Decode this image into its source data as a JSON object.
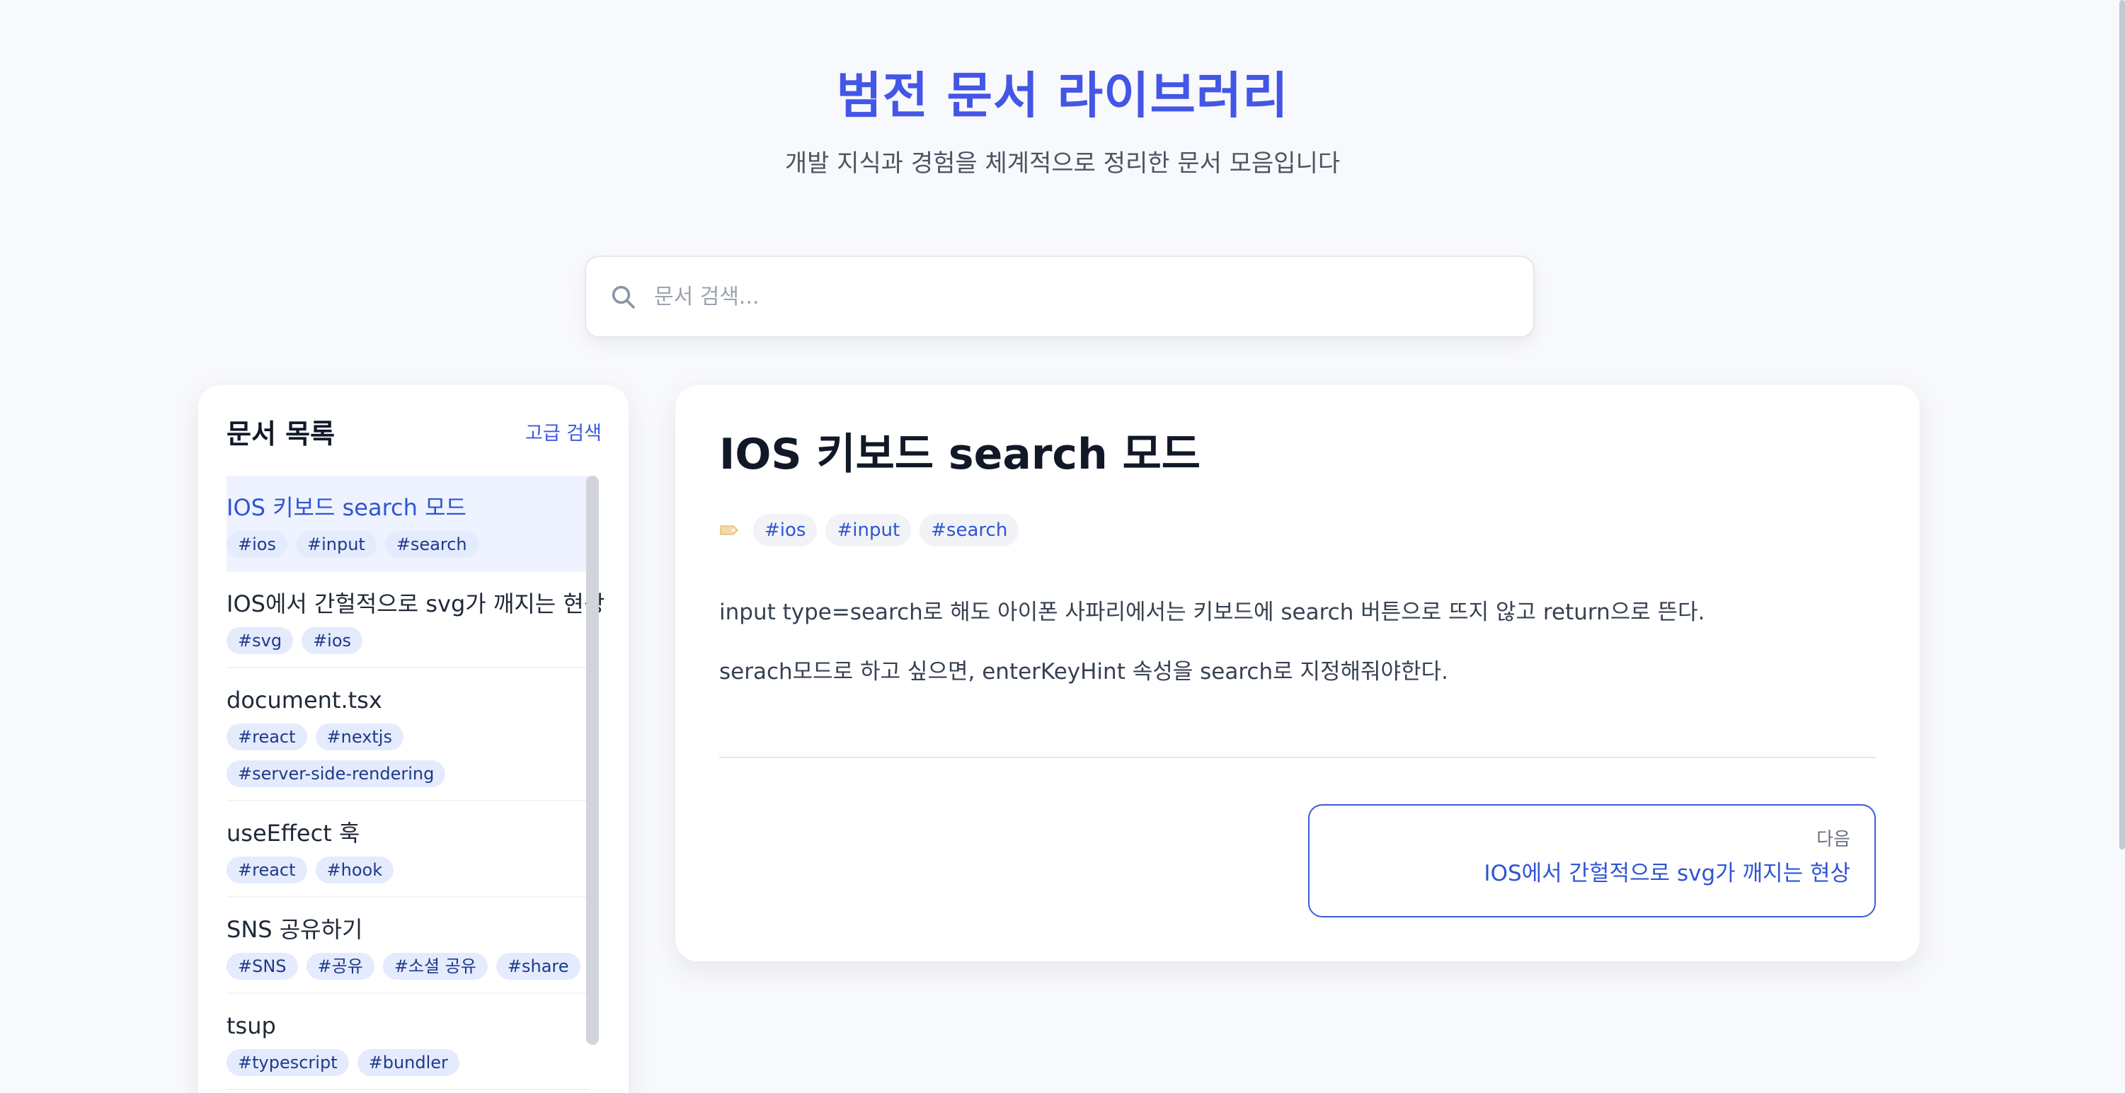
{
  "header": {
    "title": "범전 문서 라이브러리",
    "subtitle": "개발 지식과 경험을 체계적으로 정리한 문서 모음입니다"
  },
  "search": {
    "placeholder": "문서 검색...",
    "value": "",
    "icon": "search-icon"
  },
  "sidebar": {
    "title": "문서 목록",
    "advanced_search_label": "고급 검색",
    "items": [
      {
        "title": "IOS 키보드 search 모드",
        "tags": [
          "#ios",
          "#input",
          "#search"
        ],
        "active": true
      },
      {
        "title": "IOS에서 간헐적으로 svg가 깨지는 현상",
        "tags": [
          "#svg",
          "#ios"
        ]
      },
      {
        "title": "document.tsx",
        "tags": [
          "#react",
          "#nextjs",
          "#server-side-rendering"
        ]
      },
      {
        "title": "useEffect 훅",
        "tags": [
          "#react",
          "#hook"
        ]
      },
      {
        "title": "SNS 공유하기",
        "tags": [
          "#SNS",
          "#공유",
          "#소셜 공유",
          "#share"
        ]
      },
      {
        "title": "tsup",
        "tags": [
          "#typescript",
          "#bundler"
        ]
      }
    ]
  },
  "document": {
    "title": "IOS 키보드 search 모드",
    "tags": [
      "#ios",
      "#input",
      "#search"
    ],
    "paragraphs": [
      "input type=search로 해도 아이폰 사파리에서는 키보드에 search 버튼으로 뜨지 않고 return으로 뜬다.",
      "serach모드로 하고 싶으면, enterKeyHint 속성을 search로 지정해줘야한다."
    ],
    "next": {
      "label": "다음",
      "title": "IOS에서 간헐적으로 svg가 깨지는 현상"
    }
  },
  "colors": {
    "accent": "#4356e5",
    "link": "#3b5bdb",
    "tag_bg": "#e4ebfd",
    "active_bg": "#eef3ff"
  }
}
